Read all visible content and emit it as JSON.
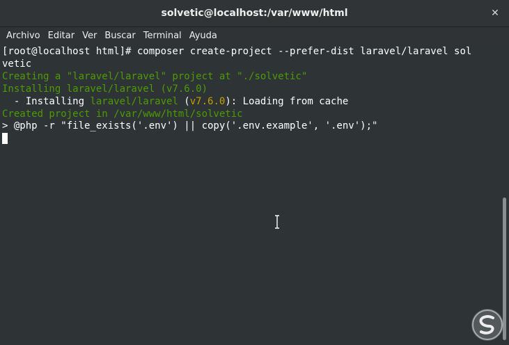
{
  "window": {
    "title": "solvetic@localhost:/var/www/html",
    "close_glyph": "✕"
  },
  "menu": {
    "items": [
      "Archivo",
      "Editar",
      "Ver",
      "Buscar",
      "Terminal",
      "Ayuda"
    ]
  },
  "terminal": {
    "line1": "[root@localhost html]# composer create-project --prefer-dist laravel/laravel sol",
    "line2": "vetic",
    "line3": "Creating a \"laravel/laravel\" project at \"./solvetic\"",
    "line4": "Installing laravel/laravel (v7.6.0)",
    "line5_prefix": "  - Installing ",
    "line5_pkg": "laravel/laravel",
    "line5_paren_open": " (",
    "line5_ver": "v7.6.0",
    "line5_suffix": "): Loading from cache",
    "line6": "Created project in /var/www/html/solvetic",
    "line7": "> @php -r \"file_exists('.env') || copy('.env.example', '.env');\""
  },
  "colors": {
    "background": "#2e3436",
    "green": "#4e9a06",
    "yellow": "#c4a000",
    "foreground": "#ffffff"
  },
  "icons": {
    "close": "close-icon",
    "cursor": "text-cursor-icon",
    "watermark": "solvetic-logo"
  }
}
